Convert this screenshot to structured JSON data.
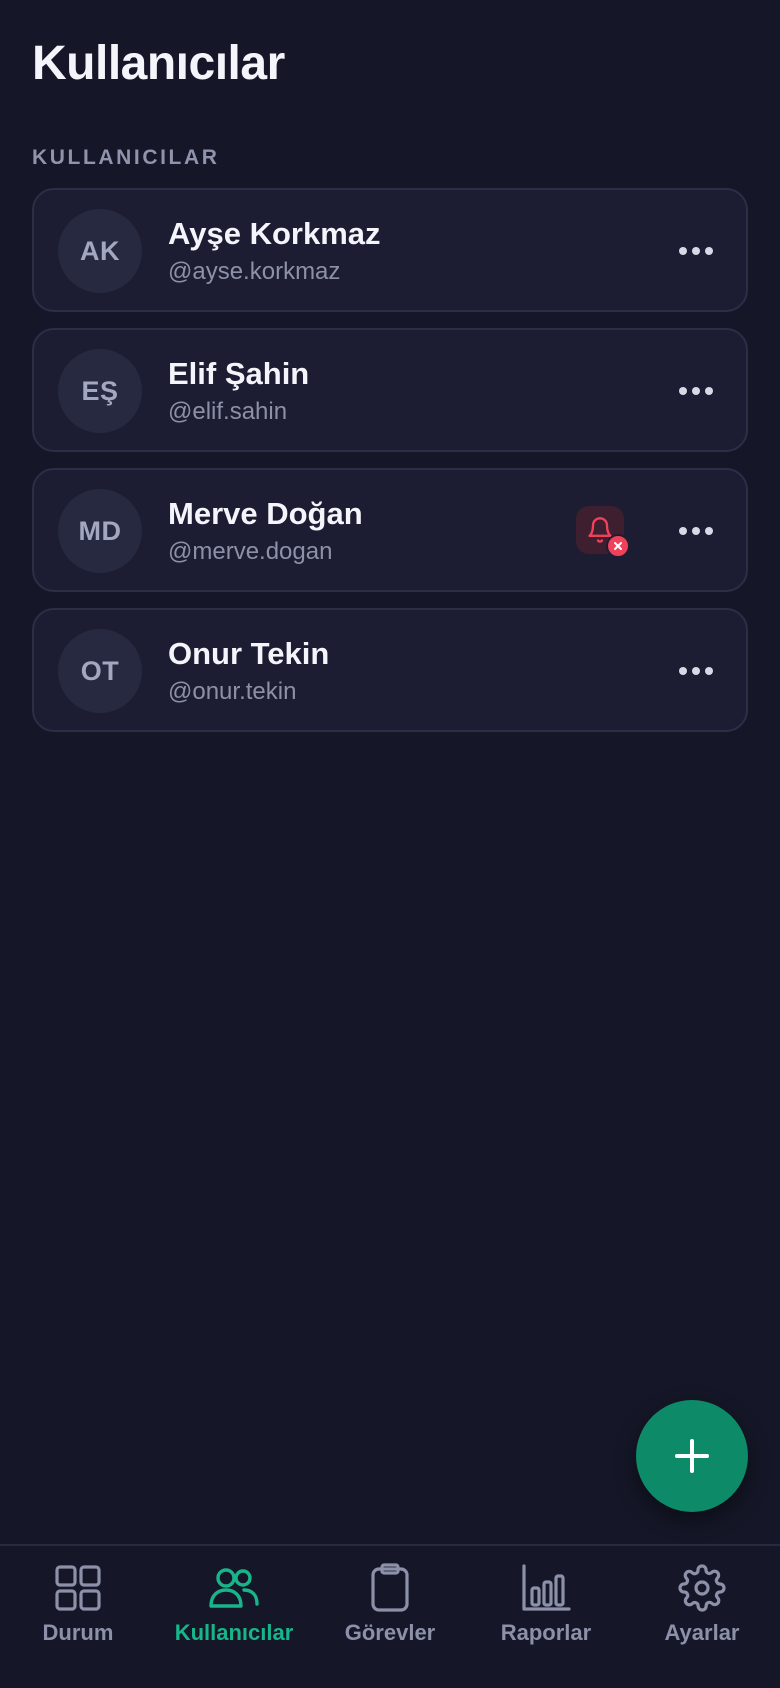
{
  "header": {
    "title": "Kullanıcılar"
  },
  "section": {
    "label": "KULLANICILAR"
  },
  "users": [
    {
      "initials": "AK",
      "name": "Ayşe Korkmaz",
      "handle": "@ayse.korkmaz",
      "notifications_muted": false
    },
    {
      "initials": "EŞ",
      "name": "Elif Şahin",
      "handle": "@elif.sahin",
      "notifications_muted": false
    },
    {
      "initials": "MD",
      "name": "Merve Doğan",
      "handle": "@merve.dogan",
      "notifications_muted": true
    },
    {
      "initials": "OT",
      "name": "Onur Tekin",
      "handle": "@onur.tekin",
      "notifications_muted": false
    }
  ],
  "fab": {
    "icon": "plus-icon"
  },
  "tabs": [
    {
      "label": "Durum",
      "icon": "grid-icon",
      "active": false
    },
    {
      "label": "Kullanıcılar",
      "icon": "users-icon",
      "active": true
    },
    {
      "label": "Görevler",
      "icon": "clipboard-icon",
      "active": false
    },
    {
      "label": "Raporlar",
      "icon": "bar-chart-icon",
      "active": false
    },
    {
      "label": "Ayarlar",
      "icon": "gear-icon",
      "active": false
    }
  ],
  "colors": {
    "background": "#151728",
    "card": "#1c1d32",
    "accent": "#18b58a",
    "fab": "#0d8a67",
    "danger": "#f0415b",
    "muted_text": "#8c90a8"
  }
}
